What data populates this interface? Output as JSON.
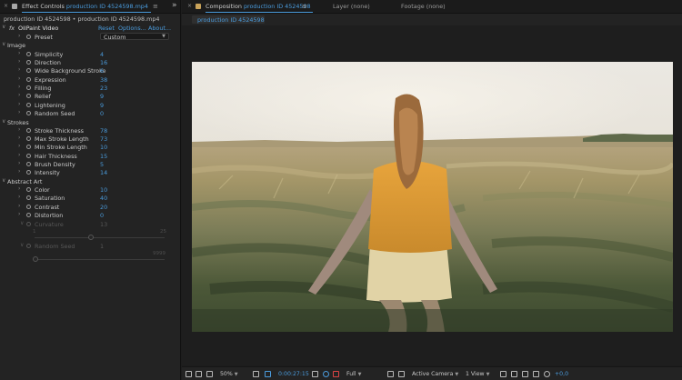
{
  "effect_controls": {
    "tab_prefix": "Effect Controls",
    "tab_file": "production ID 4524598.mp4",
    "subtitle": "production ID 4524598 • production ID 4524598.mp4",
    "fx_label": "fx",
    "effect_name": "OilPaint Video",
    "reset": "Reset",
    "options": "Options...",
    "about": "About...",
    "preset": {
      "label": "Preset",
      "value": "Custom"
    },
    "groups": [
      {
        "name": "Image",
        "params": [
          {
            "label": "Simplicity",
            "value": "4"
          },
          {
            "label": "Direction",
            "value": "16"
          },
          {
            "label": "Wide Background Stroke",
            "value": "6"
          },
          {
            "label": "Expression",
            "value": "38"
          },
          {
            "label": "Filling",
            "value": "23"
          },
          {
            "label": "Relief",
            "value": "9"
          },
          {
            "label": "Lightening",
            "value": "9"
          },
          {
            "label": "Random Seed",
            "value": "0"
          }
        ]
      },
      {
        "name": "Strokes",
        "params": [
          {
            "label": "Stroke Thickness",
            "value": "78"
          },
          {
            "label": "Max Stroke Length",
            "value": "73"
          },
          {
            "label": "Min Stroke Length",
            "value": "10"
          },
          {
            "label": "Hair Thickness",
            "value": "15"
          },
          {
            "label": "Brush Density",
            "value": "5"
          },
          {
            "label": "Intensity",
            "value": "14"
          }
        ]
      },
      {
        "name": "Abstract Art",
        "params": [
          {
            "label": "Color",
            "value": "10"
          },
          {
            "label": "Saturation",
            "value": "40"
          },
          {
            "label": "Contrast",
            "value": "20"
          },
          {
            "label": "Distortion",
            "value": "0"
          }
        ]
      }
    ],
    "disabled": [
      {
        "label": "Curvature",
        "value": "13",
        "min": "1",
        "max": "25"
      },
      {
        "label": "Random Seed",
        "value": "1",
        "min": "",
        "max": "9999"
      }
    ]
  },
  "composition": {
    "tab_prefix": "Composition",
    "tab_name": "production ID 4524598",
    "layer_tab": "Layer (none)",
    "footage_tab": "Footage (none)",
    "subtab": "production ID 4524598"
  },
  "toolbar": {
    "zoom": "50%",
    "timecode": "0:00:27:15",
    "resolution": "Full",
    "camera": "Active Camera",
    "views": "1 View",
    "exposure": "+0,0"
  },
  "colors": {
    "accent": "#4a9bdc",
    "panel_bg": "#232323",
    "comp_icon": "#c9a35a"
  }
}
